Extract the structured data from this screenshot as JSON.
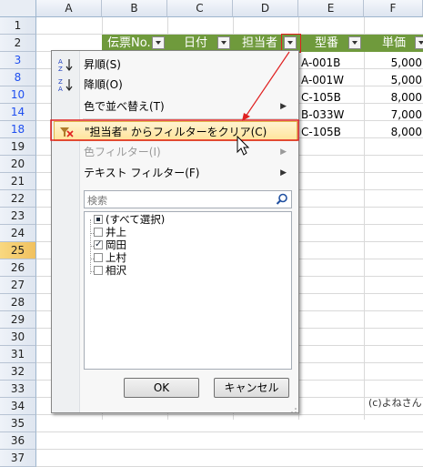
{
  "columns": [
    "A",
    "B",
    "C",
    "D",
    "E",
    "F"
  ],
  "row_numbers": [
    "1",
    "2",
    "3",
    "8",
    "10",
    "14",
    "18",
    "19",
    "20",
    "21",
    "22",
    "23",
    "24",
    "25",
    "26",
    "27",
    "28",
    "29",
    "30",
    "31",
    "32",
    "33",
    "34",
    "35",
    "36",
    "37"
  ],
  "header_row": {
    "b": "伝票No.",
    "c": "日付",
    "d": "担当者",
    "e": "型番",
    "f": "単価"
  },
  "data_rows": [
    {
      "e": "A-001B",
      "f": "5,000"
    },
    {
      "e": "A-001W",
      "f": "5,000"
    },
    {
      "e": "C-105B",
      "f": "8,000"
    },
    {
      "e": "B-033W",
      "f": "7,000"
    },
    {
      "e": "C-105B",
      "f": "8,000"
    }
  ],
  "menu": {
    "sort_asc": "昇順(S)",
    "sort_desc": "降順(O)",
    "sort_by_color": "色で並べ替え(T)",
    "clear_filter": "\"担当者\" からフィルターをクリア(C)",
    "color_filter": "色フィルター(I)",
    "text_filter": "テキスト フィルター(F)",
    "search_placeholder": "検索",
    "list": [
      {
        "label": "(すべて選択)",
        "state": "partial"
      },
      {
        "label": "井上",
        "state": "unchecked"
      },
      {
        "label": "岡田",
        "state": "checked"
      },
      {
        "label": "上村",
        "state": "unchecked"
      },
      {
        "label": "相沢",
        "state": "unchecked"
      }
    ],
    "ok": "OK",
    "cancel": "キャンセル"
  },
  "copyright": "(c)よねさん",
  "colors": {
    "header_fill": "#6f9a3c",
    "highlight_border": "#e02020",
    "filtered_row_number": "#1f4ff0"
  }
}
